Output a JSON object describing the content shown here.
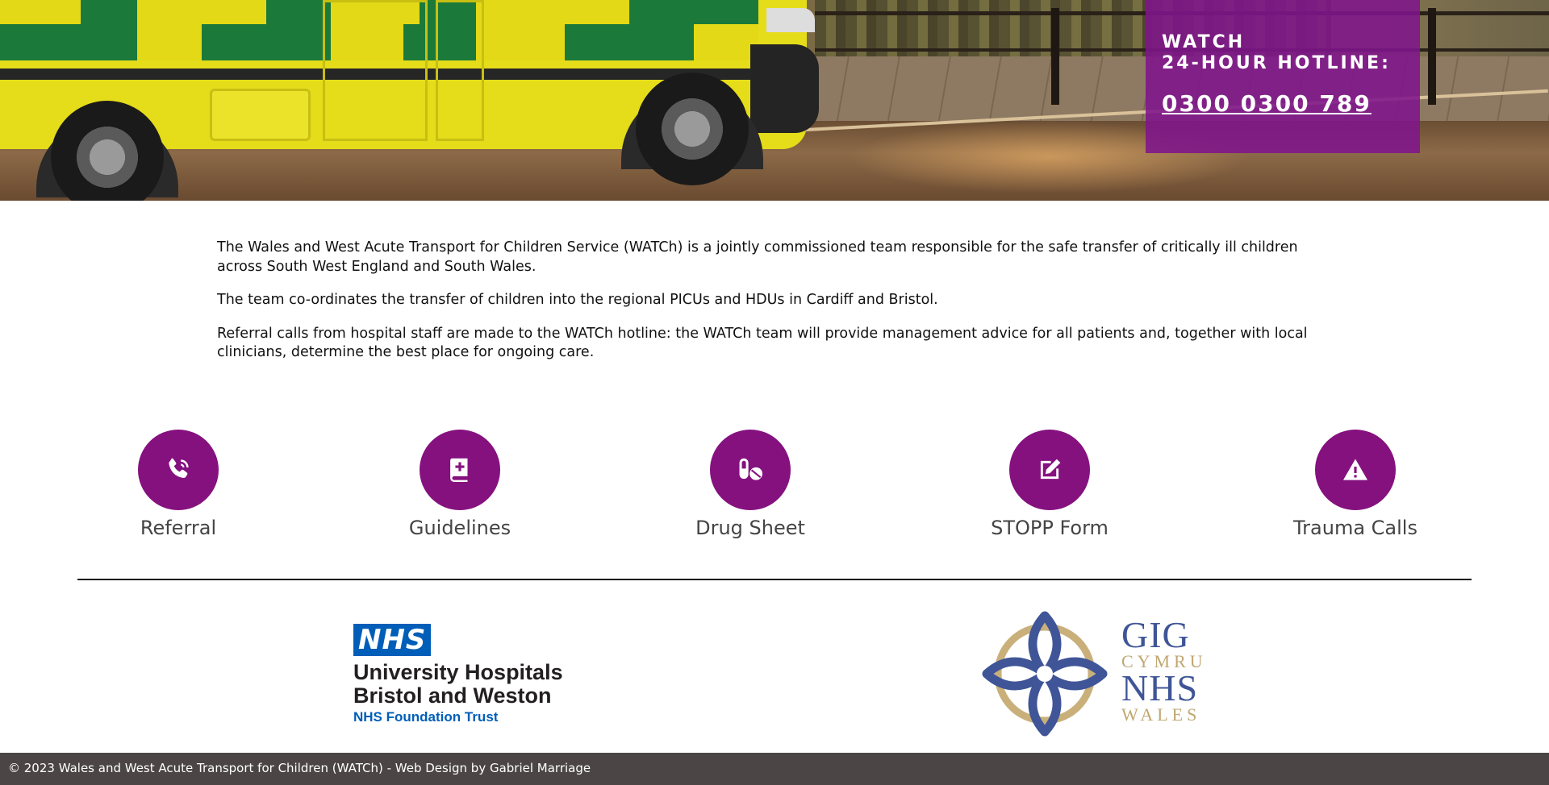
{
  "hero": {
    "hotline_title_line1": "WATCH",
    "hotline_title_line2": "24-HOUR HOTLINE:",
    "hotline_number": "0300 0300 789"
  },
  "intro": {
    "paragraphs": [
      "The Wales and West Acute Transport for Children Service (WATCh) is a jointly commissioned team responsible for the safe transfer of critically ill children across South West England and South Wales.",
      "The team co-ordinates the transfer of children into the regional PICUs and HDUs in Cardiff and Bristol.",
      "Referral calls from hospital staff are made to the WATCh hotline: the WATCh team will provide management advice for all patients and, together with local clinicians, determine the best place for ongoing care."
    ]
  },
  "quick_links": [
    {
      "label": "Referral",
      "icon": "phone-icon"
    },
    {
      "label": "Guidelines",
      "icon": "medical-book-icon"
    },
    {
      "label": "Drug Sheet",
      "icon": "pills-icon"
    },
    {
      "label": "STOPP Form",
      "icon": "edit-form-icon"
    },
    {
      "label": "Trauma Calls",
      "icon": "warning-icon"
    }
  ],
  "logos": {
    "nhs_badge": "NHS",
    "nhs_line1": "University Hospitals",
    "nhs_line2": "Bristol and Weston",
    "nhs_line3": "NHS Foundation Trust",
    "gig_line1": "GIG",
    "gig_line2": "CYMRU",
    "gig_line3": "NHS",
    "gig_line4": "WALES"
  },
  "footer": {
    "text": "© 2023 Wales and West Acute Transport for Children (WATCh) - Web Design by Gabriel Marriage"
  },
  "colors": {
    "accent_purple": "#85117f",
    "nhs_blue": "#005eb8",
    "footer_bg": "#4b4546"
  }
}
